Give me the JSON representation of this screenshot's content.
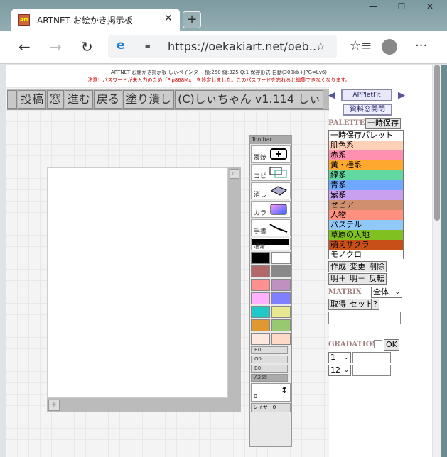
{
  "browser": {
    "tab_title": "ARTNET お絵かき掲示板",
    "favicon_text": "Art",
    "close_tab": "✕",
    "new_tab": "+",
    "minimize": "—",
    "maximize": "☐",
    "close": "✕",
    "back": "←",
    "forward": "→",
    "reload": "↻",
    "url": "https://oekakiart.net/oeb…",
    "star": "☆",
    "favorites": "☆≡",
    "menu": "···"
  },
  "page": {
    "info_line": "ARTNET お絵かき掲示板 しぃペインター 横:250 縦:325 Q:1 保存形式:自動(300kb+JPG=Lv6)",
    "warning_line": "注意！パスワードが未入力のため「Pip868Mx」を設定しました。このパスワードを忘れると編集できなくなります。"
  },
  "menubar": {
    "items": [
      "投稿",
      "窓",
      "進む",
      "戻る",
      "塗り潰し",
      "(C)しぃちゃん v1.114 しぃ"
    ]
  },
  "toolbar": {
    "header": "Toolbar",
    "tools": [
      {
        "label": "鉛筆",
        "icon": "pencil-stroke-icon"
      },
      {
        "label": "覆焼",
        "icon": "dodge-plus-icon"
      },
      {
        "label": "コピ",
        "icon": "copy-rect-icon"
      },
      {
        "label": "消し",
        "icon": "eraser-icon"
      },
      {
        "label": "カラ",
        "icon": "gradient-icon"
      },
      {
        "label": "手書",
        "icon": "freehand-icon"
      }
    ],
    "mode_label": "通常",
    "swatches": [
      [
        "#000000",
        "#ffffff"
      ],
      [
        "#b06868",
        "#888888"
      ],
      [
        "#ff9090",
        "#c090c0"
      ],
      [
        "#ffb0ff",
        "#8080ff"
      ],
      [
        "#20c8c8",
        "#e8e890"
      ],
      [
        "#e09830",
        "#98c870"
      ],
      [
        "#ffe8e0",
        "#ffd8c8"
      ]
    ],
    "sliders": [
      "R0",
      "G0",
      "B0",
      "A255"
    ],
    "size_value": "0",
    "layer_label": "レイヤー0"
  },
  "palette": {
    "title": "PALETTE",
    "temp_save": "一時保存",
    "items": [
      {
        "label": "一時保存パレット",
        "color": "#ffffff"
      },
      {
        "label": "肌色系",
        "color": "#ffd0b8"
      },
      {
        "label": "赤系",
        "color": "#ff90b0"
      },
      {
        "label": "黄・橙系",
        "color": "#ffa830"
      },
      {
        "label": "緑系",
        "color": "#60d8a0"
      },
      {
        "label": "青系",
        "color": "#70a8ff"
      },
      {
        "label": "紫系",
        "color": "#c8a0f0"
      },
      {
        "label": "セピア",
        "color": "#d09070"
      },
      {
        "label": "人物",
        "color": "#ff9080"
      },
      {
        "label": "パステル",
        "color": "#90c8f8"
      },
      {
        "label": "草原の大地",
        "color": "#80c020"
      },
      {
        "label": "萌えサクラ",
        "color": "#c85018"
      },
      {
        "label": "モノクロ",
        "color": "#ffffff"
      }
    ],
    "row1": [
      "作成",
      "変更",
      "削除"
    ],
    "row2": [
      "明＋",
      "明－",
      "反転"
    ]
  },
  "applet_fit": "APPletFit",
  "doc_window": "資料窓開閉",
  "matrix": {
    "title": "MATRIX",
    "select": "全体",
    "get": "取得",
    "set": "セット",
    "help": "?"
  },
  "gradation": {
    "title": "GRADATION",
    "ok": "OK",
    "sel1": "1",
    "sel2": "12"
  }
}
